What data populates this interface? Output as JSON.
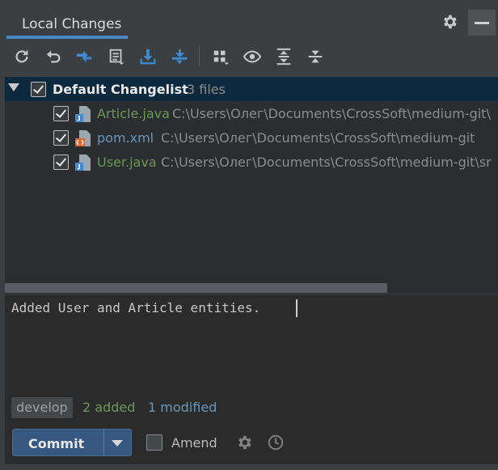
{
  "panel": {
    "title": "Local Changes"
  },
  "header_icons": [
    "gear-icon",
    "minimize-icon"
  ],
  "toolbar": {
    "icons": [
      "refresh-icon",
      "rollback-icon",
      "diff-icon",
      "changelist-icon",
      "download-icon",
      "shelve-icon",
      "group-by-icon",
      "preview-icon",
      "expand-all-icon",
      "collapse-all-icon"
    ]
  },
  "changelist": {
    "name": "Default Changelist",
    "count": "3 files",
    "files": [
      {
        "name": "Article.java",
        "path": "C:\\Users\\Олег\\Documents\\CrossSoft\\medium-git\\",
        "status": "added",
        "icon": "java-file-icon"
      },
      {
        "name": "pom.xml",
        "path": "C:\\Users\\Олег\\Documents\\CrossSoft\\medium-git",
        "status": "modified",
        "icon": "xml-file-icon"
      },
      {
        "name": "User.java",
        "path": "C:\\Users\\Олег\\Documents\\CrossSoft\\medium-git\\sr",
        "status": "added",
        "icon": "java-file-icon"
      }
    ]
  },
  "commit_message": "Added User and Article entities.",
  "status": {
    "branch": "develop",
    "added": "2 added",
    "modified": "1 modified"
  },
  "commit": {
    "button_label": "Commit",
    "amend_label": "Amend"
  },
  "colors": {
    "added": "#6a9955",
    "modified": "#6897bb",
    "accent": "#4a88c7",
    "commit_button": "#365880"
  }
}
